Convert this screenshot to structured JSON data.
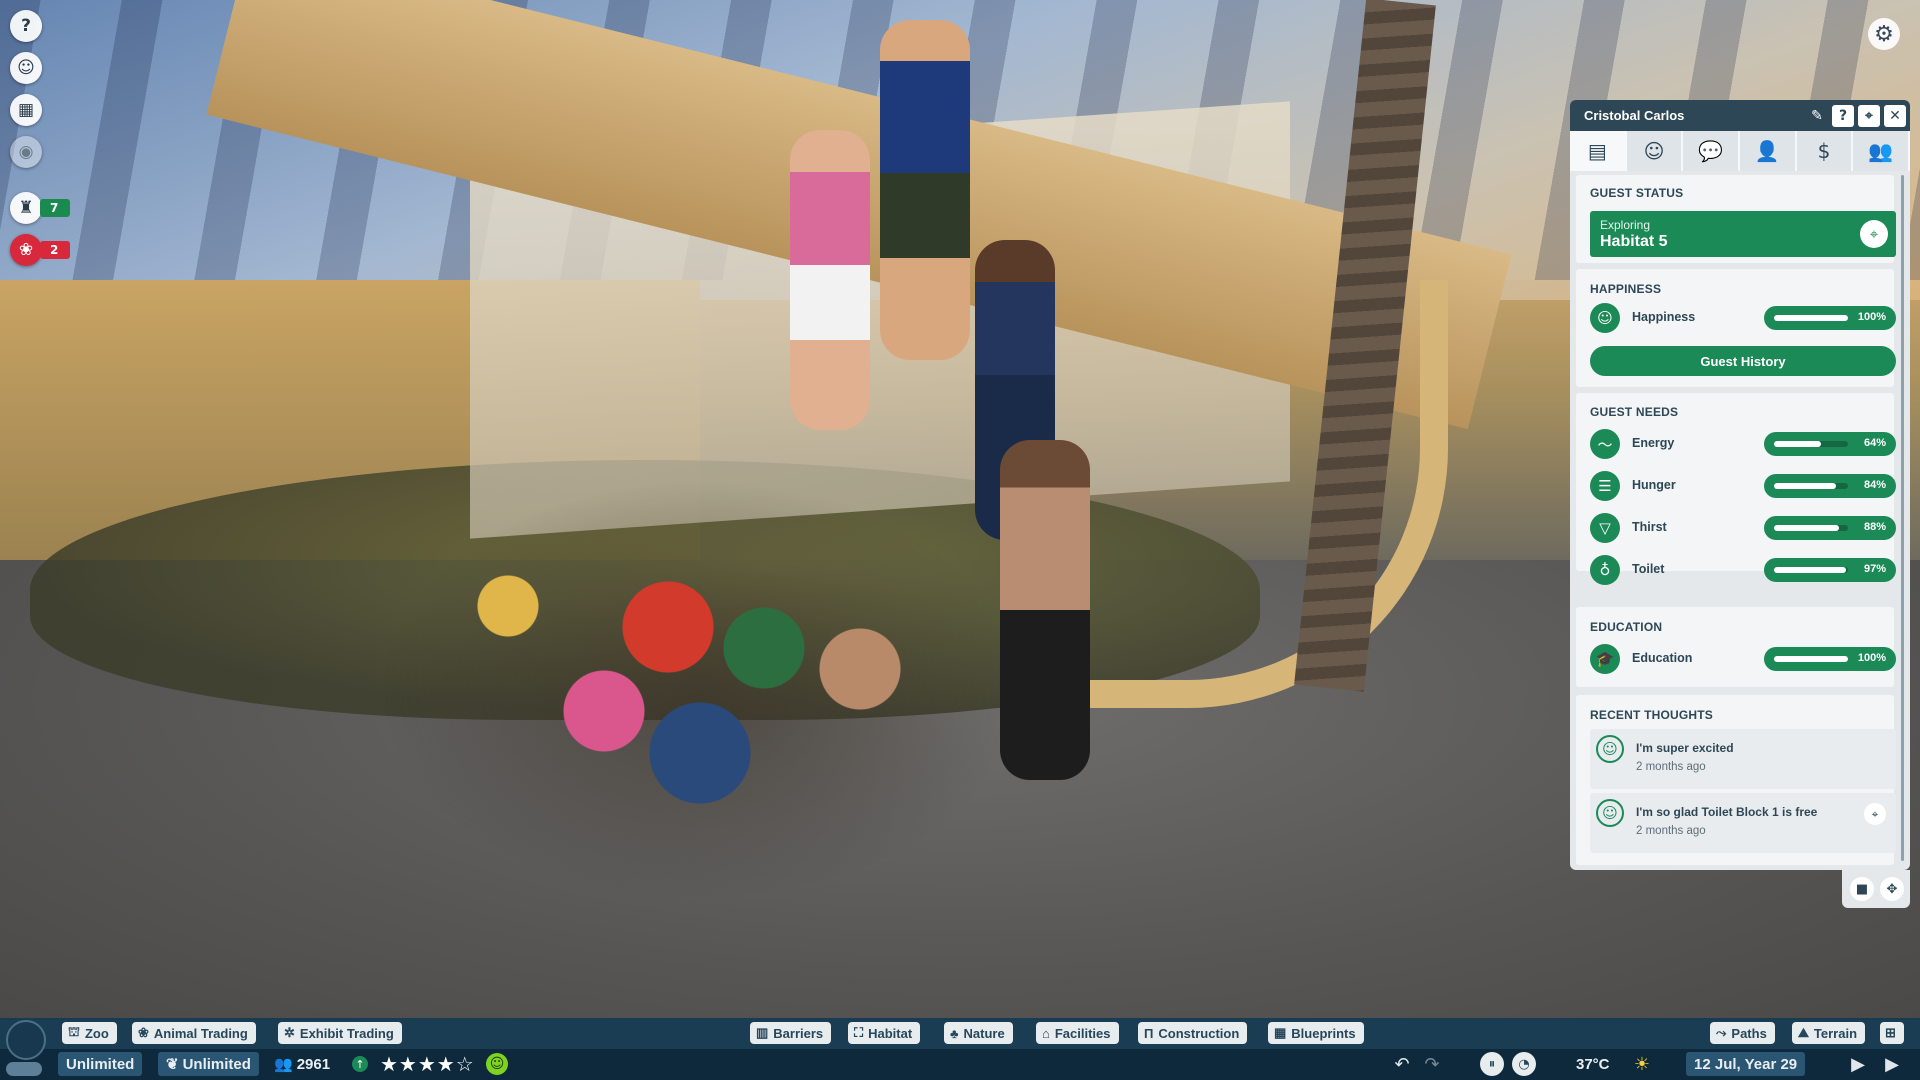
{
  "left_toolbar": {
    "help_icon": "question-icon",
    "animal_count": "7",
    "alert_count": "2"
  },
  "guest_panel": {
    "guest_name": "Cristobal Carlos",
    "status": {
      "section_title": "GUEST STATUS",
      "activity": "Exploring",
      "location": "Habitat 5"
    },
    "happiness": {
      "section_title": "HAPPINESS",
      "label": "Happiness",
      "value_text": "100%",
      "value": 1.0,
      "history_button": "Guest History"
    },
    "needs": {
      "section_title": "GUEST NEEDS",
      "items": [
        {
          "label": "Energy",
          "value_text": "64%",
          "value": 0.64,
          "icon": "energy-icon"
        },
        {
          "label": "Hunger",
          "value_text": "84%",
          "value": 0.84,
          "icon": "hunger-icon"
        },
        {
          "label": "Thirst",
          "value_text": "88%",
          "value": 0.88,
          "icon": "thirst-icon"
        },
        {
          "label": "Toilet",
          "value_text": "97%",
          "value": 0.97,
          "icon": "toilet-icon"
        }
      ]
    },
    "education": {
      "section_title": "EDUCATION",
      "label": "Education",
      "value_text": "100%",
      "value": 1.0
    },
    "thoughts": {
      "section_title": "RECENT THOUGHTS",
      "items": [
        {
          "text": "I'm super excited",
          "time": "2 months ago"
        },
        {
          "text": "I'm so glad Toilet Block 1 is free",
          "time": "2 months ago"
        }
      ]
    }
  },
  "bottom_bar": {
    "left_menu": [
      "Zoo",
      "Animal Trading",
      "Exhibit Trading"
    ],
    "center_menu": [
      "Barriers",
      "Habitat",
      "Nature",
      "Facilities",
      "Construction",
      "Blueprints"
    ],
    "right_menu": [
      "Paths",
      "Terrain"
    ],
    "money": "Unlimited",
    "conservation_credits": "Unlimited",
    "guest_count": "2961",
    "rating_stars": 4,
    "temperature": "37°C",
    "date": "12 Jul, Year 29"
  },
  "colors": {
    "accent_green": "#1b8a57",
    "panel_header": "#2e4756",
    "alert_red": "#d8283c",
    "bottom_bar": "#163a52"
  }
}
